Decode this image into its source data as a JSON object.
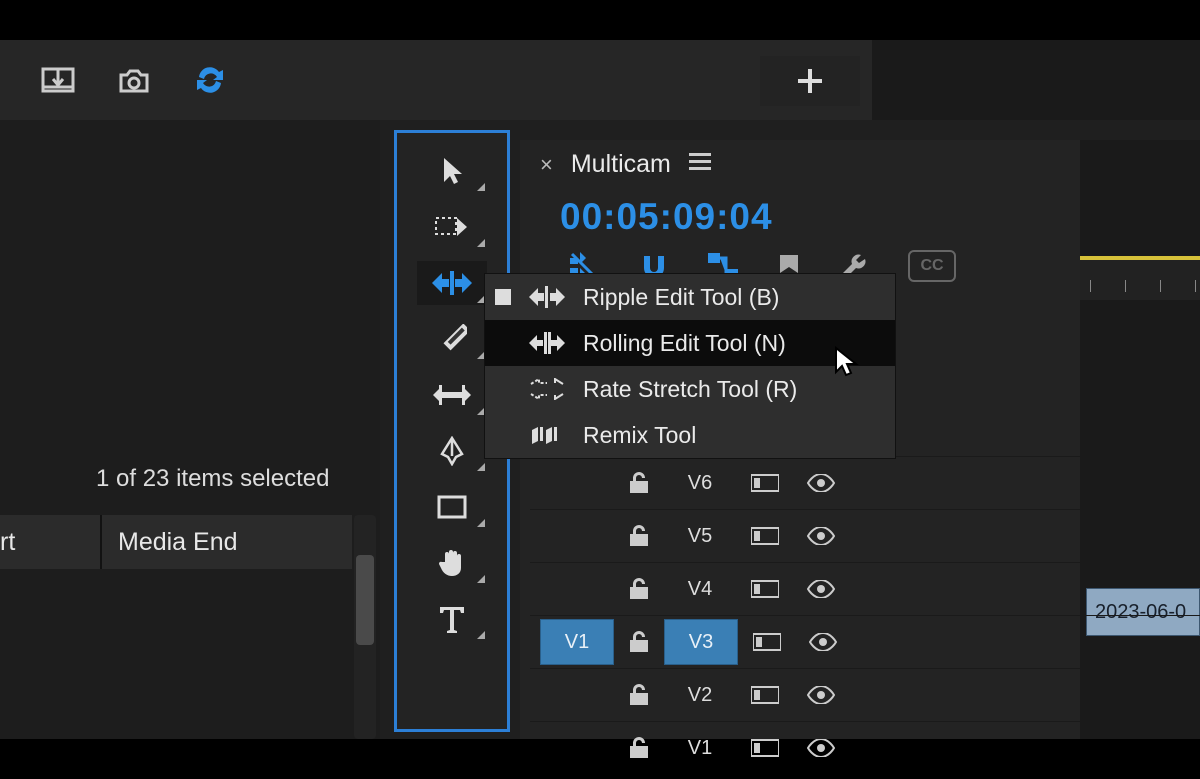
{
  "topbar": {
    "plus_label": "+"
  },
  "left_pane": {
    "status_text": "1 of 23 items selected",
    "col1_label": "rt",
    "col2_label": "Media End"
  },
  "panel": {
    "tab_name": "Multicam",
    "timecode": "00:05:09:04",
    "cc_label": "CC"
  },
  "flyout": {
    "items": [
      {
        "label": "Ripple Edit Tool (B)",
        "selected": true,
        "hover": false,
        "icon": "ripple"
      },
      {
        "label": "Rolling Edit Tool (N)",
        "selected": false,
        "hover": true,
        "icon": "rolling"
      },
      {
        "label": "Rate Stretch Tool (R)",
        "selected": false,
        "hover": false,
        "icon": "rate"
      },
      {
        "label": "Remix Tool",
        "selected": false,
        "hover": false,
        "icon": "remix"
      }
    ]
  },
  "tracks": [
    {
      "src": "",
      "tgt": "V6",
      "src_visible": false
    },
    {
      "src": "",
      "tgt": "V5",
      "src_visible": false
    },
    {
      "src": "",
      "tgt": "V4",
      "src_visible": false
    },
    {
      "src": "V1",
      "tgt": "V3",
      "src_visible": true
    },
    {
      "src": "",
      "tgt": "V2",
      "src_visible": false
    },
    {
      "src": "",
      "tgt": "V1",
      "src_visible": false
    }
  ],
  "clip": {
    "label": "2023-06-0"
  }
}
